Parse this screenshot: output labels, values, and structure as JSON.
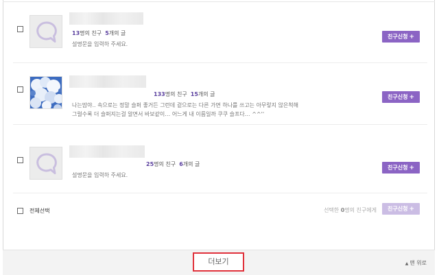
{
  "friends": [
    {
      "friend_count": "13",
      "friend_suffix": "명의 친구",
      "post_count": "5",
      "post_suffix": "개의 글",
      "description_lines": [
        "설명문을 입력하 주세요."
      ],
      "avatar": "speech-bubble-icon",
      "add_button_label": "친구신청",
      "add_button_icon": "+"
    },
    {
      "friend_count": "133",
      "friend_suffix": "명의 친구",
      "post_count": "15",
      "post_suffix": "개의 글",
      "description_lines": [
        "나는맘야.. 속으로는 정말 슬퍼 좋거든 그런데 겉으로는 다른 가면 하나를 쓰고는 아무렇지 않은척해",
        "그럴수록 더 슬퍼지는걸 알면서 바보같이… 어느게 내 이름일까 쿠쿠 슬프다… ^^''"
      ],
      "avatar": "sky-clouds-photo",
      "add_button_label": "친구신청",
      "add_button_icon": "+"
    },
    {
      "friend_count": "25",
      "friend_suffix": "명의 친구",
      "post_count": "6",
      "post_suffix": "개의 글",
      "description_lines": [
        "설명문을 입력하 주세요."
      ],
      "avatar": "speech-bubble-icon",
      "add_button_label": "친구신청",
      "add_button_icon": "+"
    }
  ],
  "select_all_label": "전체선택",
  "selection_status": {
    "prefix": "선택한",
    "count": "0",
    "suffix": "명의 친구에게"
  },
  "bulk_add_label": "친구신청",
  "bulk_add_icon": "+",
  "more_label": "더보기",
  "to_top_label": "맨 위로",
  "to_top_icon": "▲",
  "colors": {
    "accent": "#8b64c4",
    "accent_disabled": "#cbbde4",
    "count": "#5a3f9e",
    "highlight": "#e0303a"
  }
}
